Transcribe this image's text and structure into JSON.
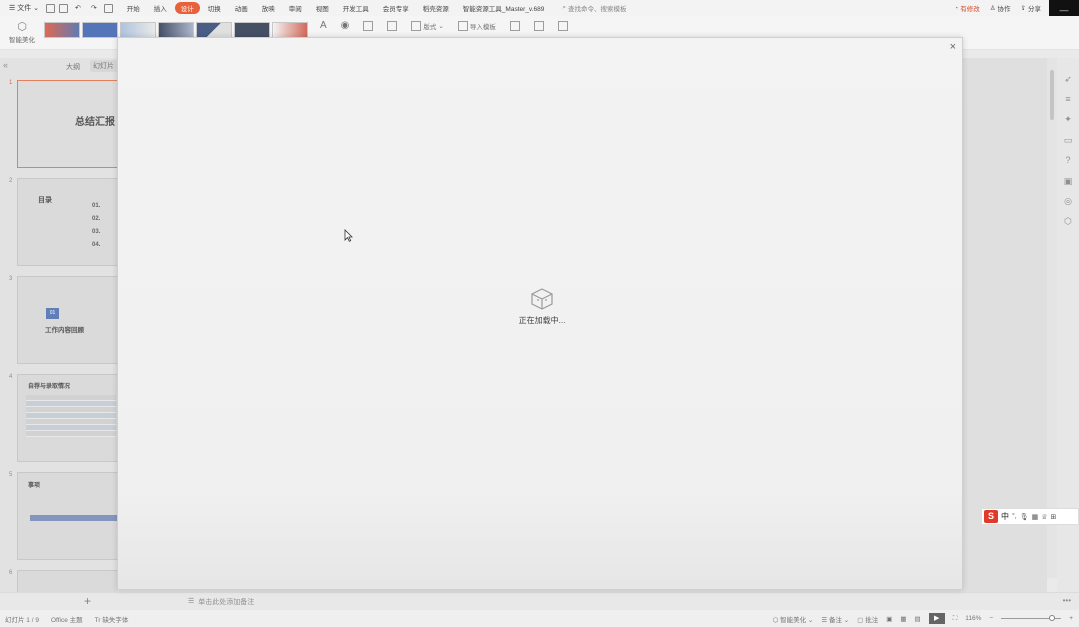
{
  "menubar": {
    "file_label": "文件",
    "tabs": [
      {
        "label": "开始",
        "active": false
      },
      {
        "label": "插入",
        "active": false
      },
      {
        "label": "设计",
        "active": true
      },
      {
        "label": "切换",
        "active": false
      },
      {
        "label": "动画",
        "active": false
      },
      {
        "label": "放映",
        "active": false
      },
      {
        "label": "审阅",
        "active": false
      },
      {
        "label": "视图",
        "active": false
      },
      {
        "label": "开发工具",
        "active": false
      },
      {
        "label": "会员专享",
        "active": false
      },
      {
        "label": "稻壳资源",
        "active": false
      },
      {
        "label": "智能资源工具_Master_v.689",
        "active": false
      }
    ],
    "search_placeholder": "查找命令、搜索模板",
    "has_changes": "有修改",
    "collaborate": "协作",
    "share": "分享",
    "accent_color": "#e8613a"
  },
  "ribbon": {
    "beautify_label": "智能美化",
    "layout_label": "版式",
    "import_template_label": "导入模板"
  },
  "left_panel": {
    "outline_tab": "大纲",
    "slides_tab": "幻灯片",
    "slides": [
      {
        "number": "1",
        "title": "总结汇报",
        "selected": true
      },
      {
        "number": "2",
        "title": "目录",
        "toc": [
          "01.",
          "02.",
          "03.",
          "04."
        ]
      },
      {
        "number": "3",
        "badge": "01",
        "title": "工作内容回顾"
      },
      {
        "number": "4",
        "title": "自荐与录取情况"
      },
      {
        "number": "5",
        "title": "事项"
      },
      {
        "number": "6"
      }
    ]
  },
  "notes": {
    "placeholder": "单击此处添加备注"
  },
  "statusbar": {
    "slide_counter": "幻灯片 1 / 9",
    "theme": "Office 主题",
    "missing_font": "缺失字体",
    "smart_beautify": "智能美化",
    "notes": "备注",
    "comments": "批注",
    "zoom": "116%"
  },
  "ime": {
    "mode": "中"
  },
  "modal": {
    "loading_text": "正在加载中..."
  }
}
